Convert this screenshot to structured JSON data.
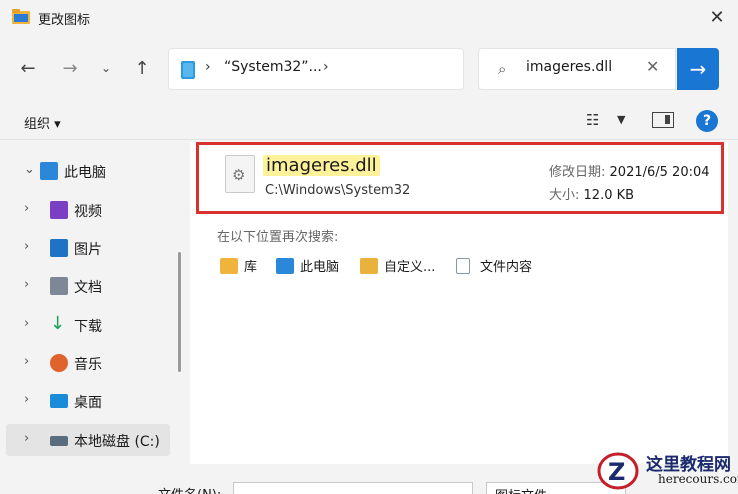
{
  "window": {
    "title": "更改图标"
  },
  "address": {
    "path": "“System32”..."
  },
  "search": {
    "value": "imageres.dll"
  },
  "toolbar": {
    "organize": "组织 ▾"
  },
  "sidebar": {
    "items": [
      {
        "label": "此电脑",
        "icon": "computer-icon",
        "color": "#2b88d8"
      },
      {
        "label": "视频",
        "icon": "video-icon",
        "color": "#7b3fc4"
      },
      {
        "label": "图片",
        "icon": "pictures-icon",
        "color": "#1f73c4"
      },
      {
        "label": "文档",
        "icon": "documents-icon",
        "color": "#7d8796"
      },
      {
        "label": "下载",
        "icon": "downloads-icon",
        "color": "#1aa25c"
      },
      {
        "label": "音乐",
        "icon": "music-icon",
        "color": "#e0622c"
      },
      {
        "label": "桌面",
        "icon": "desktop-icon",
        "color": "#1a8bd8"
      },
      {
        "label": "本地磁盘 (C:)",
        "icon": "drive-icon",
        "color": "#5a6d7d"
      }
    ]
  },
  "result": {
    "name": "imageres.dll",
    "path": "C:\\Windows\\System32",
    "modified_label": "修改日期:",
    "modified_value": "2021/6/5 20:04",
    "size_label": "大小:",
    "size_value": "12.0 KB"
  },
  "search_again": {
    "label": "在以下位置再次搜索:",
    "locations": [
      {
        "label": "库",
        "icon": "library-icon",
        "color": "#f0b43c"
      },
      {
        "label": "此电脑",
        "icon": "computer-icon",
        "color": "#2b88d8"
      },
      {
        "label": "自定义...",
        "icon": "custom-folder-icon",
        "color": "#e8b23c"
      },
      {
        "label": "文件内容",
        "icon": "document-icon",
        "color": "#8a97a8"
      }
    ]
  },
  "footer": {
    "filename_label": "文件名(N):",
    "filetype": "图标文件"
  },
  "watermark": {
    "title": "这里教程网",
    "subtitle": "herecours.com"
  },
  "colors": {
    "accent": "#1976d2",
    "highlight_border": "#d93030",
    "match_highlight": "#fdf29a"
  }
}
